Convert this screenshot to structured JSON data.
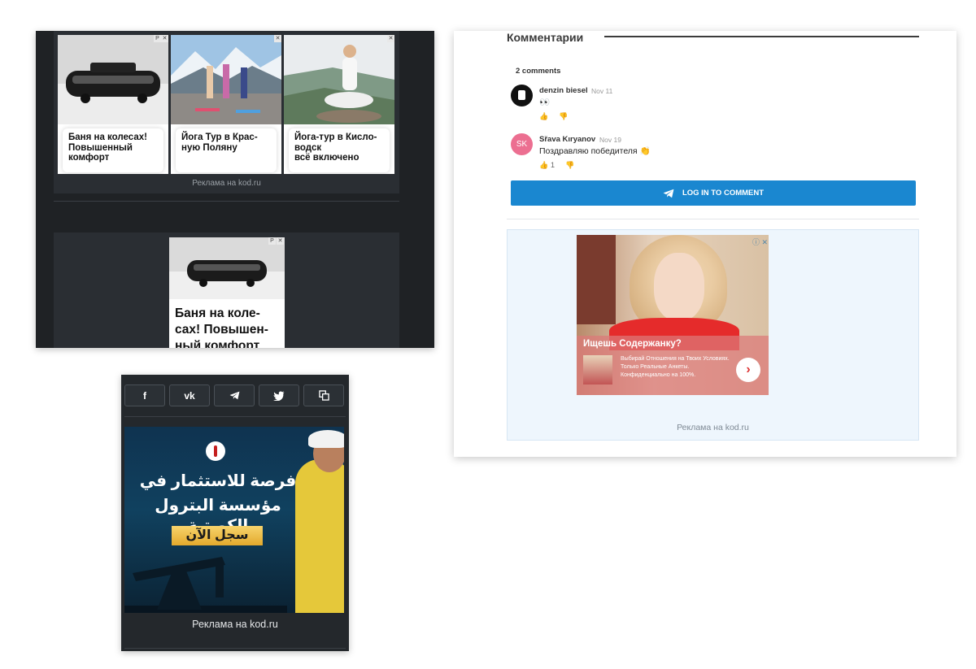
{
  "panel1": {
    "ads": [
      {
        "text": "Баня на колесах!\nПовышенный\nкомфорт",
        "corner": "P"
      },
      {
        "text": "Йога Тур в Крас-\nную Поляну",
        "corner": "P"
      },
      {
        "text": "Йога-тур в Кисло-\nводск\nвсё включено",
        "corner": "P"
      }
    ],
    "caption": "Реклама на kod.ru",
    "single_ad": {
      "text": "Баня на коле-\nсах! Повышен-\nный комфорт",
      "corner": "P"
    }
  },
  "panel2": {
    "share": [
      {
        "label": "f",
        "icon": "facebook-icon"
      },
      {
        "label": "vk",
        "icon": "vk-icon"
      },
      {
        "label": "◢",
        "icon": "telegram-icon"
      },
      {
        "label": "🐦",
        "icon": "twitter-icon"
      },
      {
        "label": "⧉",
        "icon": "copy-icon"
      }
    ],
    "ad": {
      "line1": "فرصة للاستثمار في",
      "line2": "مؤسسة البترول الكويتية",
      "cta": "سجل الآن"
    },
    "caption": "Реклама на kod.ru"
  },
  "panel3": {
    "title": "Комментарии",
    "comment_count": "2 comments",
    "comments": [
      {
        "author": "denzin biesel",
        "date": "Nov 11",
        "text": "👀",
        "likes": "",
        "avatar_color": "#111111",
        "avatar_initials": ""
      },
      {
        "author": "Sřava Kıryanov",
        "date": "Nov 19",
        "text": "Поздравляю победителя 👏",
        "likes": "1",
        "avatar_color": "#ec6f91",
        "avatar_initials": "SK"
      }
    ],
    "login_label": "LOG IN TO COMMENT",
    "ad": {
      "title": "Ищешь Содержанку?",
      "desc": "Выбирай Отношения на Твоих Условиях. Только Реальные Анкеты. Конфиденциально на 100%.",
      "close": "ⓘ ✕"
    },
    "caption": "Реклама на kod.ru"
  }
}
